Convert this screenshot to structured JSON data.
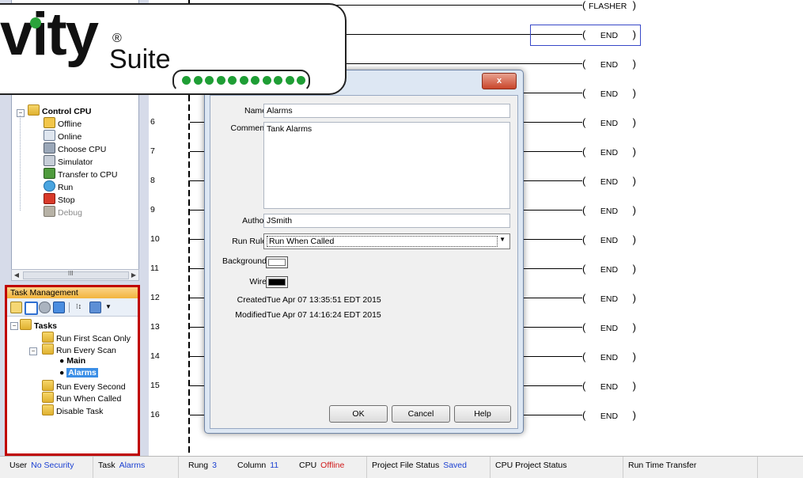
{
  "logo": {
    "main": "vity",
    "registered": "®",
    "suite": "Suite",
    "dot_color": "#1f9e35"
  },
  "project_tree": {
    "items": [
      {
        "label": "Control CPU",
        "bold": true,
        "icon": "folder-icon"
      },
      {
        "label": "Offline",
        "icon": "offline-icon"
      },
      {
        "label": "Online",
        "icon": "online-icon"
      },
      {
        "label": "Choose CPU",
        "icon": "choose-cpu-icon"
      },
      {
        "label": "Simulator",
        "icon": "simulator-icon"
      },
      {
        "label": "Transfer to CPU",
        "icon": "transfer-icon"
      },
      {
        "label": "Run",
        "icon": "run-icon"
      },
      {
        "label": "Stop",
        "icon": "stop-icon"
      },
      {
        "label": "Debug",
        "icon": "debug-icon",
        "disabled": true
      }
    ],
    "scroll_glyph": "III"
  },
  "task_management": {
    "title": "Task Management",
    "root": "Tasks",
    "items": [
      {
        "label": "Run First Scan Only"
      },
      {
        "label": "Run Every Scan"
      },
      {
        "label": "Main",
        "bold": true
      },
      {
        "label": "Alarms",
        "bold": true,
        "selected": true
      },
      {
        "label": "Run Every Second"
      },
      {
        "label": "Run When Called"
      },
      {
        "label": "Disable Task"
      }
    ]
  },
  "ladder": {
    "rung_numbers": [
      "6",
      "7",
      "8",
      "9",
      "10",
      "11",
      "12",
      "13",
      "14",
      "15",
      "16"
    ],
    "coils": [
      "FLASHER",
      "END",
      "END",
      "END",
      "END",
      "END",
      "END",
      "END",
      "END",
      "END",
      "END",
      "END",
      "END",
      "END",
      "END"
    ]
  },
  "dialog": {
    "close_label": "x",
    "name_label": "Name",
    "name_value": "Alarms",
    "comment_label": "Comment",
    "comment_value": "Tank Alarms",
    "author_label": "Author",
    "author_value": "JSmith",
    "run_rule_label": "Run Rule",
    "run_rule_value": "Run When Called",
    "background_label": "Background",
    "background_color": "#ffffff",
    "wire_label": "Wire",
    "wire_color": "#000000",
    "created_label": "Created",
    "created_value": "Tue Apr 07 13:35:51 EDT 2015",
    "modified_label": "Modified",
    "modified_value": "Tue Apr 07 14:16:24 EDT 2015",
    "ok_label": "OK",
    "cancel_label": "Cancel",
    "help_label": "Help"
  },
  "status_bar": {
    "user_label": "User",
    "user_value": "No Security",
    "task_label": "Task",
    "task_value": "Alarms",
    "rung_label": "Rung",
    "rung_value": "3",
    "column_label": "Column",
    "column_value": "11",
    "cpu_label": "CPU",
    "cpu_value": "Offline",
    "pfs_label": "Project File Status",
    "pfs_value": "Saved",
    "cps_label": "CPU Project Status",
    "rtt_label": "Run Time Transfer"
  },
  "colors": {
    "value_blue": "#1a3fd1",
    "offline_red": "#d11a1a",
    "highlight_border": "#c00000"
  }
}
